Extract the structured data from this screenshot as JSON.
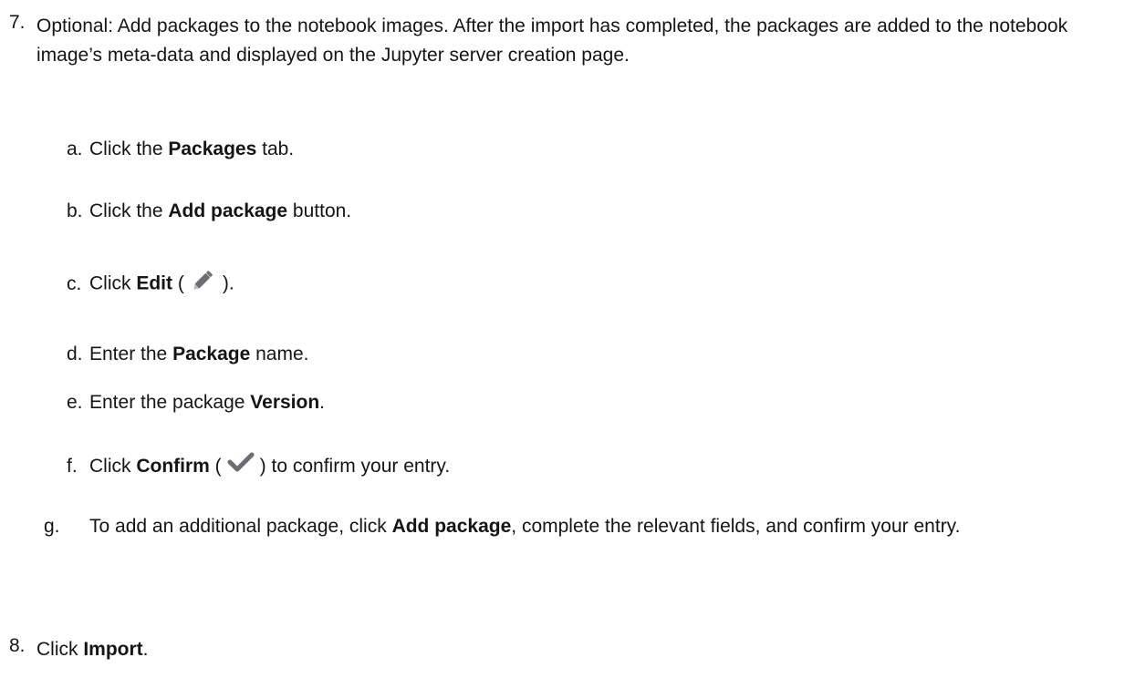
{
  "step7": {
    "number": "7.",
    "text": "Optional: Add packages to the notebook images. After the import has completed, the packages are added to the notebook image’s meta-data and displayed on the Jupyter server creation page.",
    "substeps": {
      "a": {
        "letter": "a.",
        "pre": "Click the ",
        "bold": "Packages",
        "post": " tab."
      },
      "b": {
        "letter": "b.",
        "pre": "Click the ",
        "bold": "Add package",
        "post": " button."
      },
      "c": {
        "letter": "c.",
        "pre": "Click ",
        "bold": "Edit",
        "open": " (",
        "icon": "pencil-icon",
        "close": ")."
      },
      "d": {
        "letter": "d.",
        "pre": "Enter the ",
        "bold": "Package",
        "post": " name."
      },
      "e": {
        "letter": "e.",
        "pre": "Enter the package ",
        "bold": "Version",
        "post": "."
      },
      "f": {
        "letter": "f.",
        "pre": "Click ",
        "bold": "Confirm",
        "open": " (",
        "icon": "checkmark-icon",
        "close": ") to confirm your entry."
      },
      "g": {
        "letter": "g.",
        "pre": "To add an additional package, click ",
        "bold": "Add package",
        "post": ", complete the relevant fields, and confirm your entry."
      }
    }
  },
  "step8": {
    "number": "8.",
    "pre": "Click ",
    "bold": "Import",
    "post": "."
  }
}
